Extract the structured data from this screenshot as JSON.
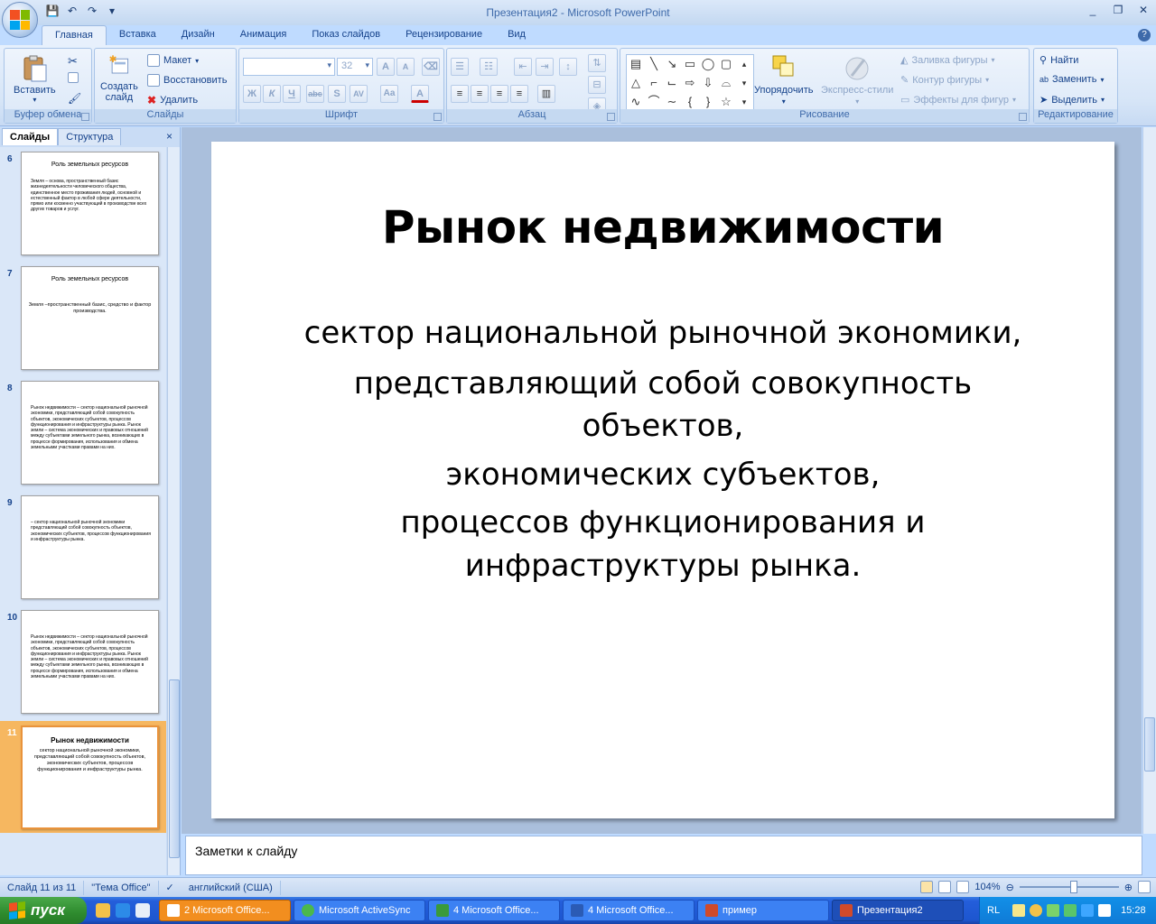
{
  "window": {
    "title": "Презентация2 - Microsoft PowerPoint"
  },
  "tabs": [
    "Главная",
    "Вставка",
    "Дизайн",
    "Анимация",
    "Показ слайдов",
    "Рецензирование",
    "Вид"
  ],
  "ribbon": {
    "clipboard": {
      "label": "Буфер обмена",
      "paste": "Вставить"
    },
    "slides": {
      "label": "Слайды",
      "new_slide_1": "Создать",
      "new_slide_2": "слайд",
      "layout": "Макет",
      "reset": "Восстановить",
      "delete": "Удалить"
    },
    "font": {
      "label": "Шрифт",
      "family": "",
      "size": "32"
    },
    "paragraph": {
      "label": "Абзац"
    },
    "drawing": {
      "label": "Рисование",
      "arrange": "Упорядочить",
      "quick_styles": "Экспресс-стили",
      "fill": "Заливка фигуры",
      "outline": "Контур фигуры",
      "effects": "Эффекты для фигур"
    },
    "editing": {
      "label": "Редактирование",
      "find": "Найти",
      "replace": "Заменить",
      "select": "Выделить"
    }
  },
  "pane": {
    "tab_slides": "Слайды",
    "tab_outline": "Структура"
  },
  "thumbnails": [
    {
      "num": "6",
      "title": "Роль земельных ресурсов",
      "body": "Земля – основа, пространственный базис жизнедеятельности человеческого общества, единственное место проживания людей, основной и естественный фактор в любой сфере деятельности, прямо или косвенно участвующий в производстве всех других товаров и услуг."
    },
    {
      "num": "7",
      "title": "Роль земельных ресурсов",
      "body": "Земля –пространственный базис, средство и фактор производства."
    },
    {
      "num": "8",
      "title": "",
      "body": "Рынок недвижимости – сектор национальной рыночной экономики, представляющий собой совокупность объектов, экономических субъектов, процессов функционирования и инфраструктуры рынка. Рынок земли – система экономических и правовых отношений между субъектами земельного рынка, возникающих в процессе формирования, использования и обмена земельными участками правами на них."
    },
    {
      "num": "9",
      "title": "",
      "body": "– сектор национальной рыночной экономики представляющий собой совокупность объектов, экономических субъектов, процессов функционирования и инфраструктуры рынка."
    },
    {
      "num": "10",
      "title": "",
      "body": "Рынок недвижимости – сектор национальной рыночной экономики, представляющий собой совокупность объектов, экономических субъектов, процессов функционирования и инфраструктуры рынка. Рынок земли – система экономических и правовых отношений между субъектами земельного рынка, возникающих в процессе формирования, использования и обмена земельными участками правами на них."
    },
    {
      "num": "11",
      "title": "Рынок недвижимости",
      "body": "сектор национальной рыночной экономики, представляющий собой совокупность объектов, экономических субъектов, процессов функционирования и инфраструктуры рынка."
    }
  ],
  "slide": {
    "title": "Рынок недвижимости",
    "lines": [
      "сектор национальной рыночной экономики,",
      "представляющий собой совокупность объектов,",
      "экономических субъектов,",
      "процессов функционирования и инфраструктуры рынка."
    ]
  },
  "notes": {
    "placeholder": "Заметки к слайду"
  },
  "status": {
    "slide_of": "Слайд 11 из 11",
    "theme": "\"Тема Office\"",
    "language": "английский (США)",
    "zoom": "104%"
  },
  "taskbar": {
    "start": "пуск",
    "tasks": [
      "2 Microsoft Office...",
      "Microsoft ActiveSync",
      "4 Microsoft Office...",
      "4 Microsoft Office...",
      "пример",
      "Презентация2"
    ],
    "lang": "RL",
    "clock": "15:28"
  }
}
